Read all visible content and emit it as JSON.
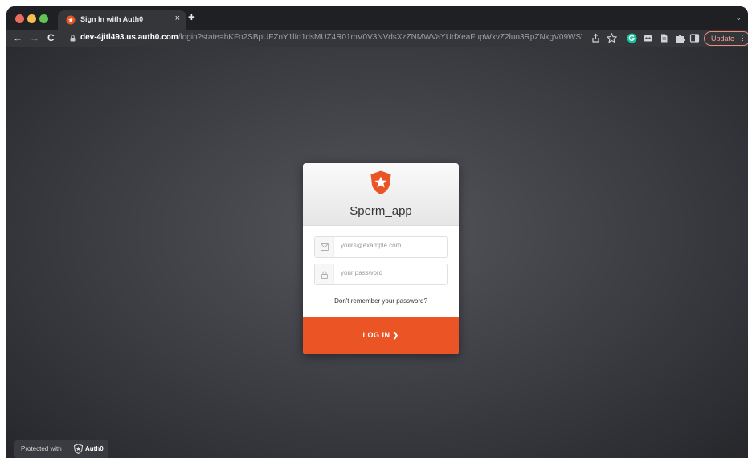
{
  "browser": {
    "tab": {
      "title": "Sign In with Auth0",
      "close": "×"
    },
    "new_tab": "+",
    "nav": {
      "back": "←",
      "forward": "→",
      "reload": "C"
    },
    "url_host": "dev-4jitl493.us.auth0.com",
    "url_path": "/login?state=hKFo2SBpUFZnY1lfd1dsMUZ4R01mV0V3NVdsXzZNMWVaYUdXeaFupWxvZ2luo3RpZNkgV09WSW...",
    "update_label": "Update",
    "update_menu": "⋮",
    "tabs_chevron": "⌄"
  },
  "lock": {
    "app_name": "Sperm_app",
    "email_placeholder": "yours@example.com",
    "password_placeholder": "your password",
    "forgot_link": "Don't remember your password?",
    "login_button": "LOG IN",
    "login_arrow": "❯"
  },
  "badge": {
    "text": "Protected with",
    "brand": "Auth0"
  },
  "colors": {
    "accent": "#eb5424",
    "browser_bg": "#1f2023",
    "toolbar_bg": "#35363a"
  }
}
